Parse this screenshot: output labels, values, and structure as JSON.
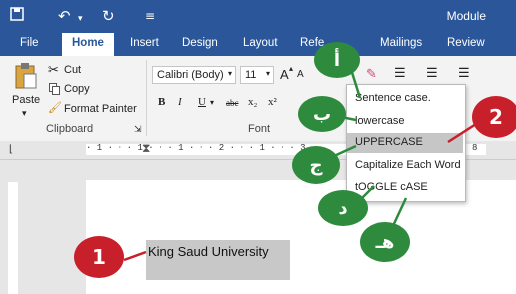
{
  "titlebar": {
    "title": "Module",
    "undo_icon": "undo-icon",
    "redo_icon": "redo-icon",
    "save_icon": "save-icon"
  },
  "tabs": [
    "File",
    "Home",
    "Insert",
    "Design",
    "Layout",
    "Refe",
    "Mailings",
    "Review"
  ],
  "clipboard": {
    "paste": "Paste",
    "cut": "Cut",
    "copy": "Copy",
    "format_painter": "Format Painter",
    "label": "Clipboard"
  },
  "font": {
    "name": "Calibri (Body)",
    "size": "11",
    "label": "Font",
    "grow": "A",
    "shrink": "A",
    "bold": "B",
    "italic": "I",
    "underline": "U",
    "strike": "abc",
    "subscript": "x₂",
    "superscript": "x²"
  },
  "ruler": {
    "marks": "· 1 · ⋅ · 1 · ⋅ · 1 · ⋅ · 2 · ⋅ · 1 · ⋅ · 3 ·",
    "end_mark": "8"
  },
  "document": {
    "selected_text": "King Saud University"
  },
  "change_case_menu": [
    "Sentence case.",
    "lowercase",
    "UPPERCASE",
    "Capitalize Each Word",
    "tOGGLE cASE"
  ],
  "callouts": {
    "red_1": "1",
    "red_2": "2",
    "green_a": "أ",
    "green_b": "ب",
    "green_c": "ج",
    "green_d": "د",
    "green_e": "هـ"
  },
  "colors": {
    "word_blue": "#2b579a",
    "callout_green": "#2e8b3e",
    "callout_red": "#c8202a",
    "highlight": "#c6c6c6"
  }
}
